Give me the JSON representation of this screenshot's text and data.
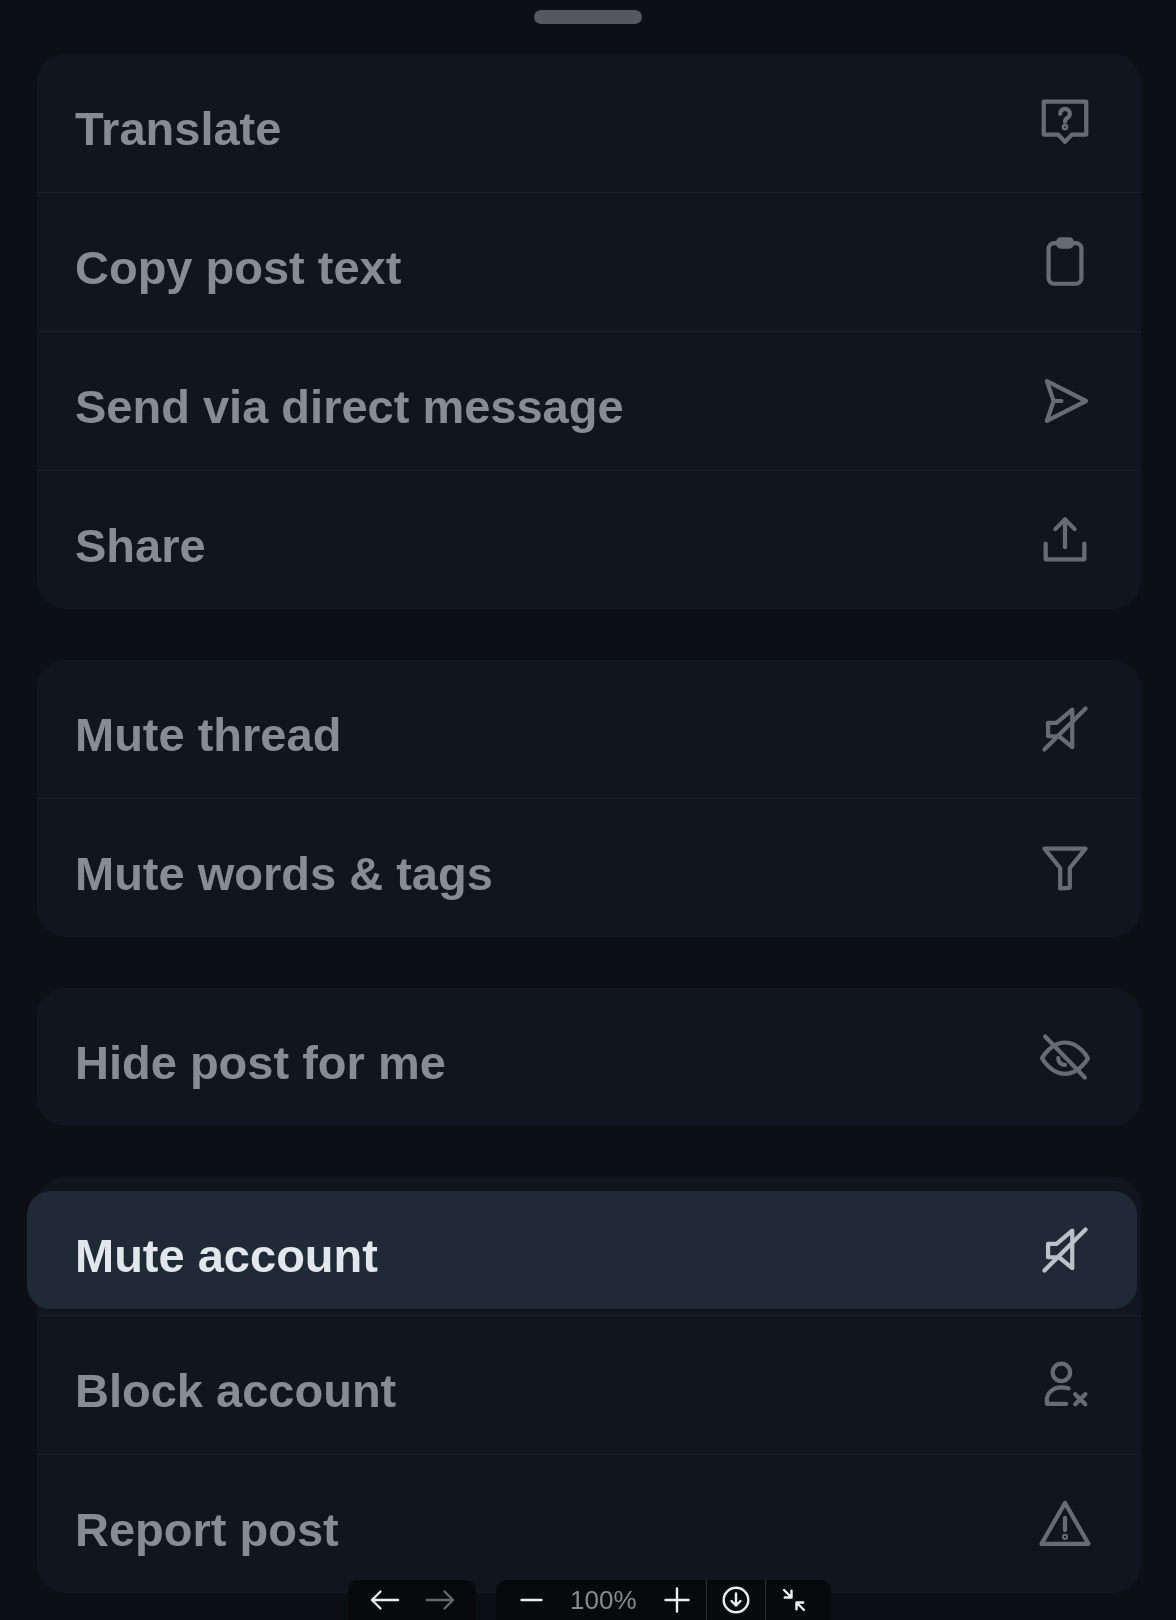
{
  "menu_groups": [
    {
      "items": [
        {
          "kind": "translate",
          "label": "Translate",
          "selected": false
        },
        {
          "kind": "copy",
          "label": "Copy post text",
          "selected": false
        },
        {
          "kind": "send",
          "label": "Send via direct message",
          "selected": false
        },
        {
          "kind": "share",
          "label": "Share",
          "selected": false
        }
      ]
    },
    {
      "items": [
        {
          "kind": "mute",
          "label": "Mute thread",
          "selected": false
        },
        {
          "kind": "filter",
          "label": "Mute words & tags",
          "selected": false
        }
      ]
    },
    {
      "items": [
        {
          "kind": "hide",
          "label": "Hide post for me",
          "selected": false
        }
      ]
    },
    {
      "items": [
        {
          "kind": "mute",
          "label": "Mute account",
          "selected": true
        },
        {
          "kind": "block",
          "label": "Block account",
          "selected": false
        },
        {
          "kind": "report",
          "label": "Report post",
          "selected": false
        }
      ]
    }
  ],
  "viewer_toolbar": {
    "nav": [
      {
        "kind": "back",
        "disabled": false
      },
      {
        "kind": "forward",
        "disabled": true
      }
    ],
    "zoom_level": "100%"
  }
}
